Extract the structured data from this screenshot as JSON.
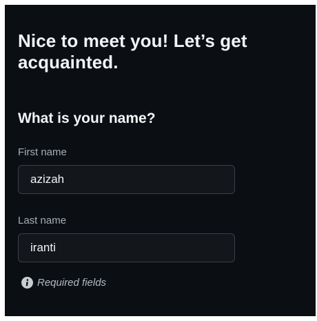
{
  "form": {
    "heading": "Nice to meet you! Let’s get acquainted.",
    "question": "What is your name?",
    "first_name": {
      "label": "First name",
      "value": "azizah"
    },
    "last_name": {
      "label": "Last name",
      "value": "iranti"
    },
    "required_note": "Required fields",
    "required_icon": "info-icon"
  },
  "colors": {
    "background": "#0b0f13",
    "text": "#f2f4f6",
    "label": "#a6adb5",
    "input_background": "#13171c",
    "input_border": "#3a4048"
  }
}
